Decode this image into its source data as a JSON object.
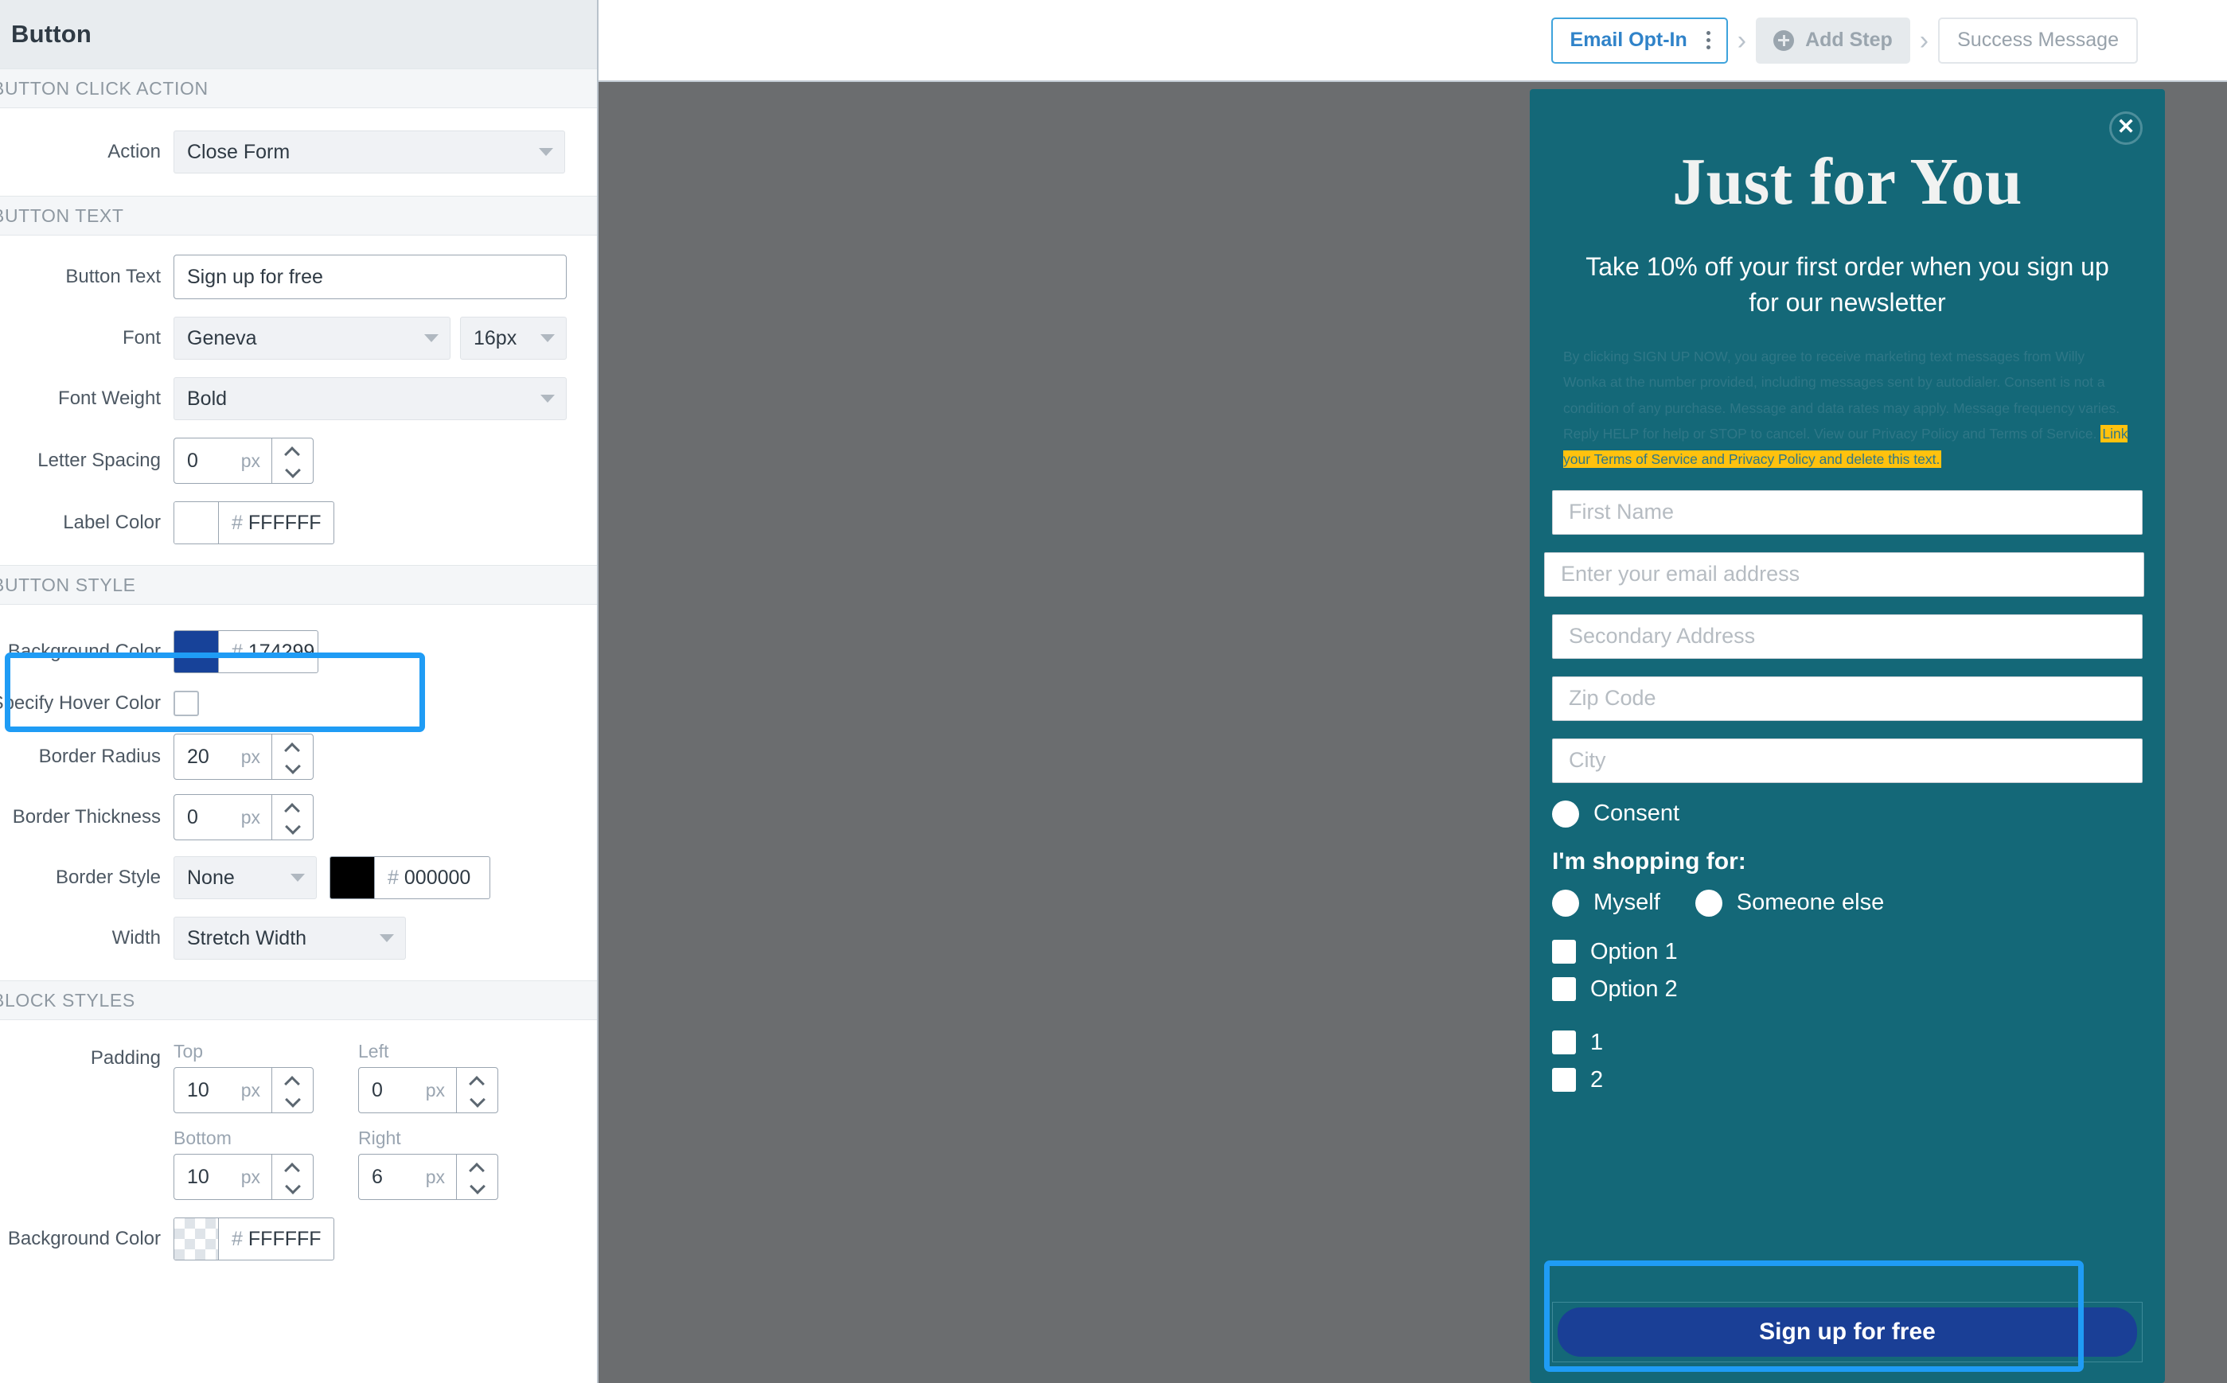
{
  "topbar": {
    "steps": [
      {
        "label": "Email Opt-In",
        "state": "active",
        "menu_icon": "kebab-menu-icon"
      },
      {
        "label": "Add Step",
        "state": "add",
        "icon": "plus-circle-icon"
      },
      {
        "label": "Success Message",
        "state": "inactive"
      }
    ],
    "separator": "›"
  },
  "panel": {
    "title": "Button",
    "sections": {
      "click_action": "BUTTON CLICK ACTION",
      "button_text": "BUTTON TEXT",
      "button_style": "BUTTON STYLE",
      "block_styles": "BLOCK STYLES"
    },
    "fields": {
      "action": {
        "label": "Action",
        "value": "Close Form"
      },
      "button_text": {
        "label": "Button Text",
        "value": "Sign up for free"
      },
      "font": {
        "label": "Font",
        "value": "Geneva",
        "size": "16px"
      },
      "font_weight": {
        "label": "Font Weight",
        "value": "Bold"
      },
      "letter_spacing": {
        "label": "Letter Spacing",
        "value": "0",
        "unit": "px"
      },
      "label_color": {
        "label": "Label Color",
        "hex": "FFFFFF",
        "swatch": "#FFFFFF"
      },
      "background_color": {
        "label": "Background Color",
        "hex": "174299",
        "swatch": "#174299"
      },
      "specify_hover_color": {
        "label": "Specify Hover Color",
        "checked": false
      },
      "border_radius": {
        "label": "Border Radius",
        "value": "20",
        "unit": "px"
      },
      "border_thickness": {
        "label": "Border Thickness",
        "value": "0",
        "unit": "px"
      },
      "border_style": {
        "label": "Border Style",
        "value": "None",
        "hex": "000000",
        "swatch": "#000000"
      },
      "width": {
        "label": "Width",
        "value": "Stretch Width"
      },
      "padding": {
        "label": "Padding",
        "top": {
          "caption": "Top",
          "value": "10",
          "unit": "px"
        },
        "left": {
          "caption": "Left",
          "value": "0",
          "unit": "px"
        },
        "bottom": {
          "caption": "Bottom",
          "value": "10",
          "unit": "px"
        },
        "right": {
          "caption": "Right",
          "value": "6",
          "unit": "px"
        }
      },
      "block_background_color": {
        "label": "Background Color",
        "hex": "FFFFFF",
        "swatch": "transparent"
      }
    }
  },
  "popup": {
    "brand_color": "#146878",
    "close_icon": "close-circle-icon",
    "close_glyph": "✕",
    "title": "Just for You",
    "subtitle": "Take 10% off your first order when you sign up for our newsletter",
    "disclaimer": "By clicking SIGN UP NOW, you agree to receive marketing text messages from Willy Wonka at the number provided, including messages sent by autodialer. Consent is not a condition of any purchase. Message and data rates may apply. Message frequency varies. Reply HELP for help or STOP to cancel. View our Privacy Policy and Terms of Service. ",
    "disclaimer_highlight": "Link your Terms of Service and Privacy Policy and delete this text.",
    "highlight_color": "#ffc20e",
    "inputs": [
      {
        "placeholder": "First Name",
        "name": "first-name"
      },
      {
        "placeholder": "Enter your email address",
        "name": "email"
      },
      {
        "placeholder": "Secondary Address",
        "name": "secondary-address"
      },
      {
        "placeholder": "Zip Code",
        "name": "zip-code"
      },
      {
        "placeholder": "City",
        "name": "city"
      }
    ],
    "consent": {
      "label": "Consent",
      "type": "radio"
    },
    "shopping_for": {
      "heading": "I'm shopping for:",
      "options": [
        {
          "label": "Myself"
        },
        {
          "label": "Someone else"
        }
      ]
    },
    "checkbox_group_1": [
      {
        "label": "Option 1"
      },
      {
        "label": "Option 2"
      }
    ],
    "checkbox_group_2": [
      {
        "label": "1"
      },
      {
        "label": "2"
      }
    ],
    "cta": {
      "label": "Sign up for free",
      "background": "#1a3f96",
      "text_color": "#FFFFFF"
    }
  },
  "annotations": {
    "highlight_color": "#1f9cf5",
    "targets": [
      "background-color-row",
      "popup-cta-button"
    ]
  }
}
